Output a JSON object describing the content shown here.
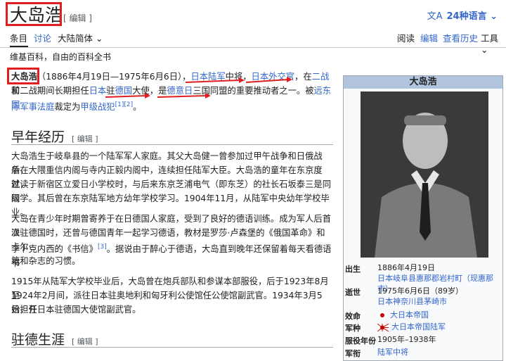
{
  "header": {
    "title": "大岛浩",
    "edit_label": "[ 编辑 ]",
    "lang_icon": "文A",
    "lang_label": "24种语言 ⌄"
  },
  "tabs": {
    "article": "条目",
    "talk": "讨论",
    "variant": "大陆简体",
    "variant_chevron": "⌄",
    "read": "阅读",
    "edit": "编辑",
    "history": "查看历史",
    "tools": "工具",
    "tools_chevron": "⌄"
  },
  "from_line": "维基百科，自由的百科全书",
  "intro": {
    "l1_a": "大岛浩",
    "l1_b": "（1886年4月19日—1975年6月6日），",
    "l1_c": "日本陆军",
    "l1_d": "中将，",
    "l1_e": "日本外交官",
    "l1_f": "，在",
    "l1_g": "二战",
    "l1_h": "前",
    "l2_a": "和二战期间长期担任",
    "l2_b": "日本",
    "l2_c": "驻",
    "l2_d": "德国",
    "l2_e": "大使，是",
    "l2_f": "德意日",
    "l2_g": "三国同盟的重要推动者之一。被",
    "l2_h": "远东国",
    "l3_a": "际军事法庭",
    "l3_b": "裁定为",
    "l3_c": "甲级战犯",
    "l3_sup": "[1][2]",
    "l3_d": "。"
  },
  "section1": {
    "heading": "早年经历",
    "edit": "[ 编辑 ]",
    "p1_1": "大岛浩生于岐阜县的一个陆军军人家庭。其父大岛健一曾参加过甲午战争和日俄战争，",
    "p1_2": "后在大隈重信内阁与寺内正毅内阁中，连续担任陆军大臣。大岛浩的童年在东京度过，",
    "p1_3": "就读于新宿区立爱日小学校时，与后来东京芝浦电气（即东芝）的社长石坂泰三是同级",
    "p1_4": "同学。其后曾在东京陆军地方幼年学校学习。1904年11月，从陆军中央幼年学校毕业。",
    "p2_1": "大岛在青少年时期曾寄养于在日德国人家庭，受到了良好的德语训练。成为军人后首次",
    "p2_2": "派驻德国时，还曾与德国青年一起学习德语，教材是罗莎·卢森堡的《俄国革命》和卡尔·",
    "p2_3a": "李卜克内西的《书信》",
    "p2_3sup": "[3]",
    "p2_3b": "。据说由于醉心于德语，大岛直到晚年还保留着每天看德语书",
    "p2_4": "籍和杂志的习惯。",
    "p3_1": "1915年从陆军大学校毕业后，大岛曾在炮兵部队和参谋本部服役，后于1923年8月至",
    "p3_2": "1924年2月间，派往日本驻奥地利和匈牙利公使馆任公使馆副武官。1934年3月5日，开",
    "p3_3": "始担任日本驻德国大使馆副武官。"
  },
  "section2": {
    "heading": "驻德生涯",
    "edit": "[ 编辑 ]"
  },
  "infobox": {
    "title": "大岛浩",
    "rows": [
      {
        "label": "出生",
        "value1": "1886年4月19日",
        "value2": "日本岐阜县惠那郡岩村町（现惠那市）"
      },
      {
        "label": "逝世",
        "value1": "1975年6月6日（89岁）",
        "value2": "日本神奈川县茅崎市"
      },
      {
        "label": "效命",
        "value1": "大日本帝国"
      },
      {
        "label": "军种",
        "value1": "大日本帝国陆军"
      },
      {
        "label": "服役年份",
        "value1": "1905年–1938年"
      },
      {
        "label": "军衔",
        "value1": "陆军中将"
      }
    ]
  }
}
